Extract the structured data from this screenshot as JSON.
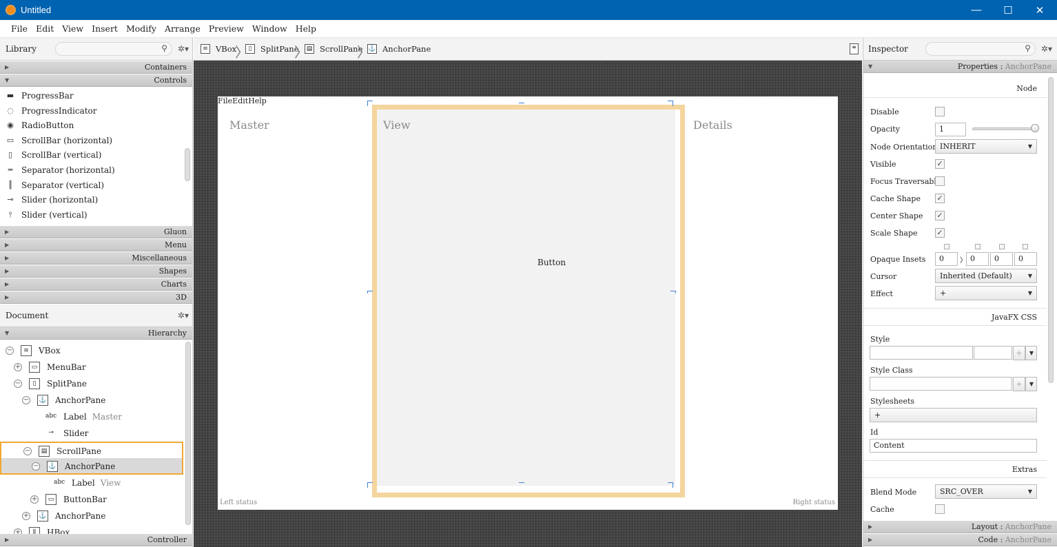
{
  "window": {
    "title": "Untitled",
    "minimize": "—",
    "maximize": "☐",
    "close": "✕"
  },
  "menu": [
    "File",
    "Edit",
    "View",
    "Insert",
    "Modify",
    "Arrange",
    "Preview",
    "Window",
    "Help"
  ],
  "library": {
    "title": "Library",
    "sections_top": [
      "Containers",
      "Controls"
    ],
    "controls": [
      {
        "icon": "progressbar-icon",
        "label": "ProgressBar"
      },
      {
        "icon": "progressindicator-icon",
        "label": "ProgressIndicator"
      },
      {
        "icon": "radiobutton-icon",
        "label": "RadioButton"
      },
      {
        "icon": "scrollbar-h-icon",
        "label": "ScrollBar  (horizontal)"
      },
      {
        "icon": "scrollbar-v-icon",
        "label": "ScrollBar  (vertical)"
      },
      {
        "icon": "separator-h-icon",
        "label": "Separator  (horizontal)"
      },
      {
        "icon": "separator-v-icon",
        "label": "Separator  (vertical)"
      },
      {
        "icon": "slider-h-icon",
        "label": "Slider  (horizontal)"
      },
      {
        "icon": "slider-v-icon",
        "label": "Slider  (vertical)"
      }
    ],
    "sections_bottom": [
      "Gluon",
      "Menu",
      "Miscellaneous",
      "Shapes",
      "Charts",
      "3D"
    ]
  },
  "document": {
    "title": "Document",
    "hierarchy_label": "Hierarchy",
    "controller_label": "Controller",
    "tree": [
      {
        "name": "VBox",
        "extra": "",
        "icon": "vbox-icon",
        "toggle": "−"
      },
      {
        "name": "MenuBar",
        "extra": "",
        "icon": "menubar-icon",
        "toggle": "+"
      },
      {
        "name": "SplitPane",
        "extra": "",
        "icon": "splitpane-icon",
        "toggle": "−"
      },
      {
        "name": "AnchorPane",
        "extra": "",
        "icon": "anchorpane-icon",
        "toggle": "−"
      },
      {
        "name": "Label",
        "extra": "Master",
        "icon": "label-icon",
        "toggle": ""
      },
      {
        "name": "Slider",
        "extra": "",
        "icon": "slider-icon",
        "toggle": ""
      },
      {
        "name": "ScrollPane",
        "extra": "",
        "icon": "scrollpane-icon",
        "toggle": "−"
      },
      {
        "name": "AnchorPane",
        "extra": "",
        "icon": "anchorpane-icon",
        "toggle": "−"
      },
      {
        "name": "Label",
        "extra": "View",
        "icon": "label-icon",
        "toggle": ""
      },
      {
        "name": "ButtonBar",
        "extra": "",
        "icon": "buttonbar-icon",
        "toggle": "+"
      },
      {
        "name": "AnchorPane",
        "extra": "",
        "icon": "anchorpane-icon",
        "toggle": "+"
      },
      {
        "name": "HBox",
        "extra": "",
        "icon": "hbox-icon",
        "toggle": "+"
      }
    ]
  },
  "breadcrumb": [
    "VBox",
    "SplitPane",
    "ScrollPane",
    "AnchorPane"
  ],
  "canvas": {
    "menu_text": "FileEditHelp",
    "master": "Master",
    "view": "View",
    "details": "Details",
    "button": "Button",
    "left_status": "Left status",
    "right_status": "Right status"
  },
  "inspector": {
    "title": "Inspector",
    "properties_label": "Properties",
    "properties_target": "AnchorPane",
    "node_section": "Node",
    "disable": "Disable",
    "opacity": "Opacity",
    "opacity_value": "1",
    "opacity_slider_value": 1.0,
    "node_orientation": "Node Orientation",
    "node_orientation_value": "INHERIT",
    "visible": "Visible",
    "focus_traversable": "Focus Traversable",
    "cache_shape": "Cache Shape",
    "center_shape": "Center Shape",
    "scale_shape": "Scale Shape",
    "opaque_insets": "Opaque Insets",
    "insets": [
      "0",
      "0",
      "0",
      "0"
    ],
    "cursor": "Cursor",
    "cursor_value": "Inherited (Default)",
    "effect": "Effect",
    "effect_value": "+",
    "css_section": "JavaFX CSS",
    "style": "Style",
    "style_class": "Style Class",
    "stylesheets": "Stylesheets",
    "stylesheets_value": "+",
    "id": "Id",
    "id_value": "Content",
    "extras_section": "Extras",
    "blend_mode": "Blend Mode",
    "blend_mode_value": "SRC_OVER",
    "cache": "Cache",
    "layout_label": "Layout",
    "layout_target": "AnchorPane",
    "code_label": "Code",
    "code_target": "AnchorPane"
  }
}
